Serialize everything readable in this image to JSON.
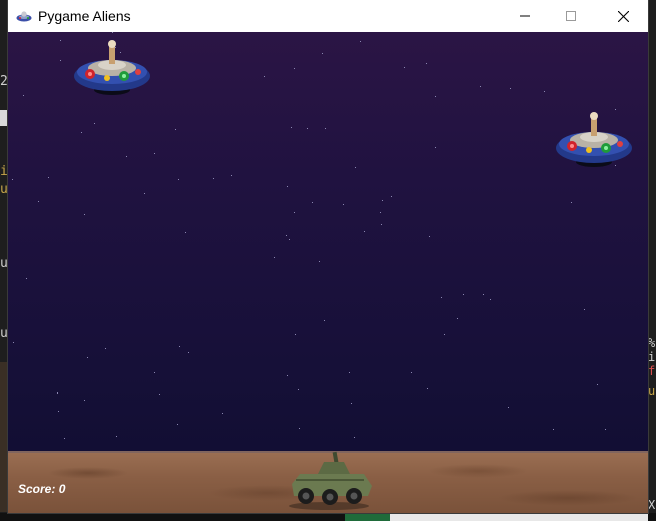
{
  "window": {
    "title": "Pygame Aliens",
    "controls": {
      "minimize": "minimize",
      "maximize": "maximize",
      "close": "close"
    }
  },
  "game": {
    "score_label": "Score:",
    "score_value": "0",
    "aliens_visible": 2,
    "icons": {
      "app": "ufo-icon",
      "alien": "ufo-alien-sprite",
      "player": "tank-sprite"
    }
  },
  "background_text": {
    "left": [
      "2",
      "i",
      "u",
      "u",
      "u"
    ],
    "right": [
      "%",
      "i",
      "f",
      "u",
      "X"
    ]
  },
  "colors": {
    "sky_top": "#2b1545",
    "sky_bottom": "#0f0d30",
    "ground": "#8a5f45",
    "score_text": "#ffffff"
  }
}
